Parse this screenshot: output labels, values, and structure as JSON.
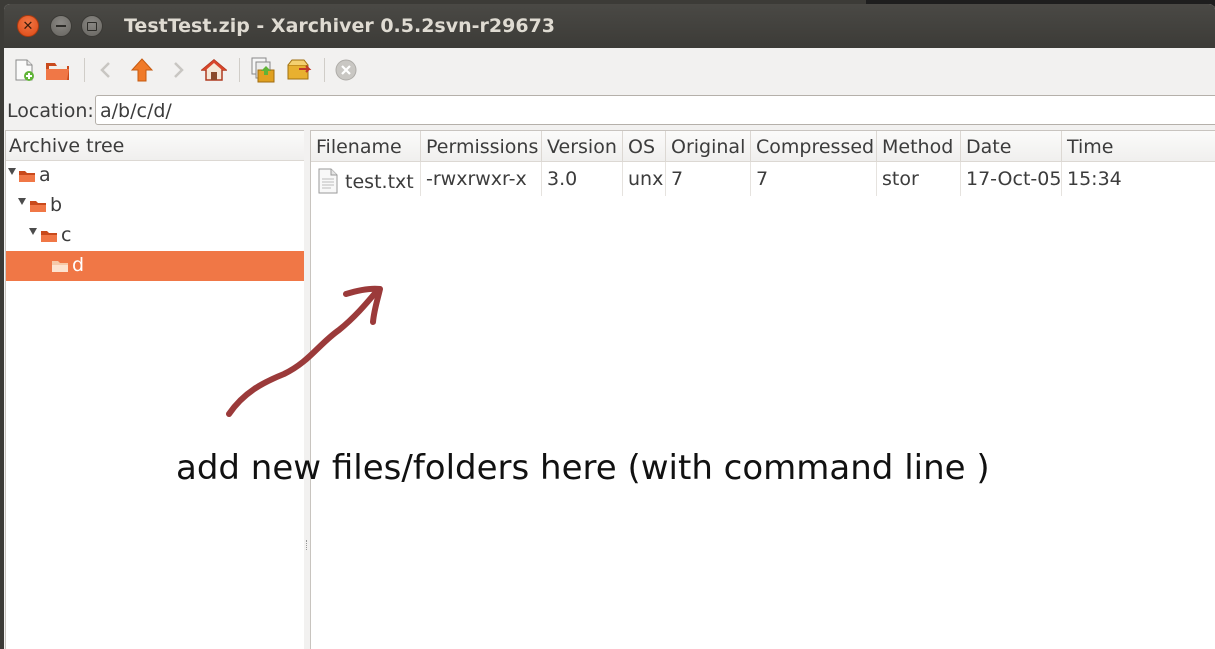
{
  "window": {
    "title": "TestTest.zip - Xarchiver 0.5.2svn-r29673"
  },
  "toolbar": {
    "icons": [
      "new-archive-icon",
      "open-archive-icon",
      "back-icon",
      "up-icon",
      "forward-icon",
      "home-icon",
      "extract-icon",
      "add-icon",
      "stop-icon"
    ]
  },
  "location": {
    "label": "Location:",
    "value": "a/b/c/d/"
  },
  "tree": {
    "header": "Archive tree",
    "items": [
      {
        "label": "a",
        "level": 0,
        "expanded": true,
        "selected": false
      },
      {
        "label": "b",
        "level": 1,
        "expanded": true,
        "selected": false
      },
      {
        "label": "c",
        "level": 2,
        "expanded": true,
        "selected": false
      },
      {
        "label": "d",
        "level": 3,
        "expanded": false,
        "selected": true
      }
    ]
  },
  "list": {
    "columns": [
      "Filename",
      "Permissions",
      "Version",
      "OS",
      "Original",
      "Compressed",
      "Method",
      "Date",
      "Time"
    ],
    "rows": [
      {
        "filename": "test.txt",
        "permissions": "-rwxrwxr-x",
        "version": "3.0",
        "os": "unx",
        "original": "7",
        "compressed": "7",
        "method": "stor",
        "date": "17-Oct-05",
        "time": "15:34"
      }
    ]
  },
  "annotation": {
    "text": "add new files/folders here (with command line )",
    "arrow_color": "#9b3a3a"
  },
  "colors": {
    "selection": "#f07746",
    "titlebar": "#3c3b37",
    "close_button": "#dd4814"
  }
}
